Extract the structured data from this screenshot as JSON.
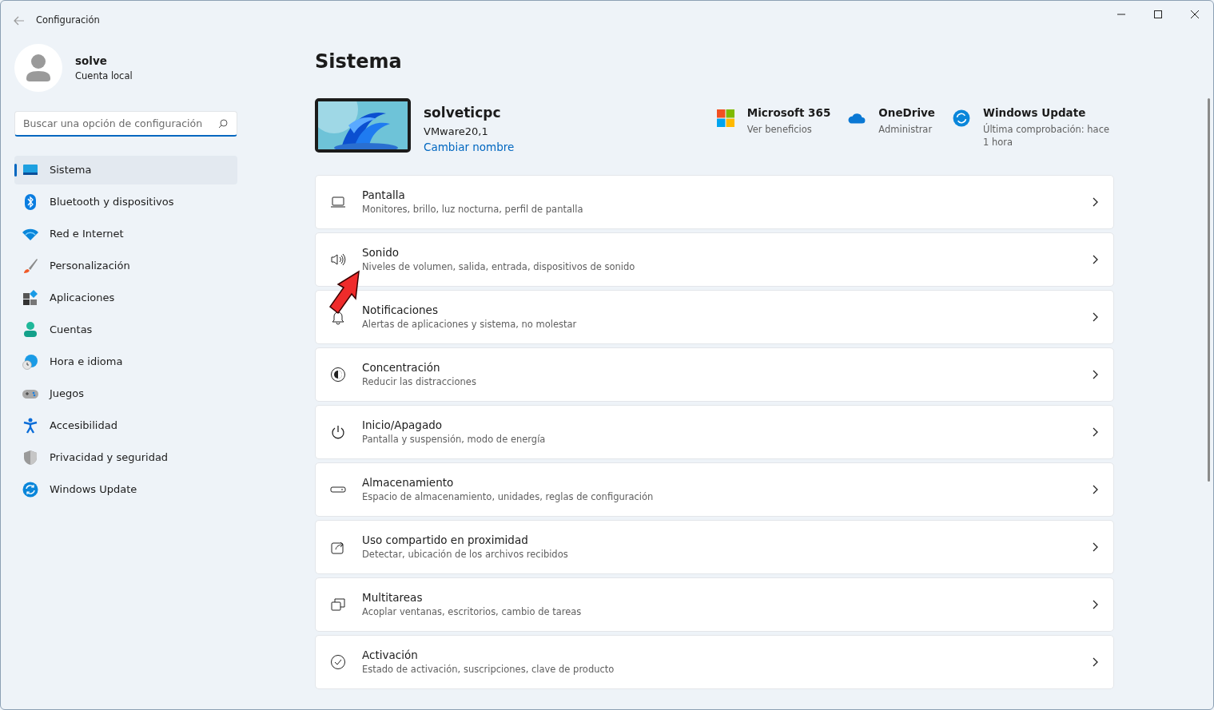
{
  "window": {
    "title": "Configuración"
  },
  "user": {
    "name": "solve",
    "account": "Cuenta local"
  },
  "search": {
    "placeholder": "Buscar una opción de configuración"
  },
  "sidebar": {
    "items": [
      {
        "label": "Sistema",
        "selected": true
      },
      {
        "label": "Bluetooth y dispositivos",
        "selected": false
      },
      {
        "label": "Red e Internet",
        "selected": false
      },
      {
        "label": "Personalización",
        "selected": false
      },
      {
        "label": "Aplicaciones",
        "selected": false
      },
      {
        "label": "Cuentas",
        "selected": false
      },
      {
        "label": "Hora e idioma",
        "selected": false
      },
      {
        "label": "Juegos",
        "selected": false
      },
      {
        "label": "Accesibilidad",
        "selected": false
      },
      {
        "label": "Privacidad y seguridad",
        "selected": false
      },
      {
        "label": "Windows Update",
        "selected": false
      }
    ]
  },
  "page_title": "Sistema",
  "device": {
    "name": "solveticpc",
    "model": "VMware20,1",
    "rename_link": "Cambiar nombre"
  },
  "services": [
    {
      "title": "Microsoft 365",
      "subtitle": "Ver beneficios"
    },
    {
      "title": "OneDrive",
      "subtitle": "Administrar"
    },
    {
      "title": "Windows Update",
      "subtitle": "Última comprobación: hace 1 hora"
    }
  ],
  "settings": [
    {
      "title": "Pantalla",
      "description": "Monitores, brillo, luz nocturna, perfil de pantalla"
    },
    {
      "title": "Sonido",
      "description": "Niveles de volumen, salida, entrada, dispositivos de sonido"
    },
    {
      "title": "Notificaciones",
      "description": "Alertas de aplicaciones y sistema, no molestar"
    },
    {
      "title": "Concentración",
      "description": "Reducir las distracciones"
    },
    {
      "title": "Inicio/Apagado",
      "description": "Pantalla y suspensión, modo de energía"
    },
    {
      "title": "Almacenamiento",
      "description": "Espacio de almacenamiento, unidades, reglas de configuración"
    },
    {
      "title": "Uso compartido en proximidad",
      "description": "Detectar, ubicación de los archivos recibidos"
    },
    {
      "title": "Multitareas",
      "description": "Acoplar ventanas, escritorios, cambio de tareas"
    },
    {
      "title": "Activación",
      "description": "Estado de activación, suscripciones, clave de producto"
    }
  ]
}
